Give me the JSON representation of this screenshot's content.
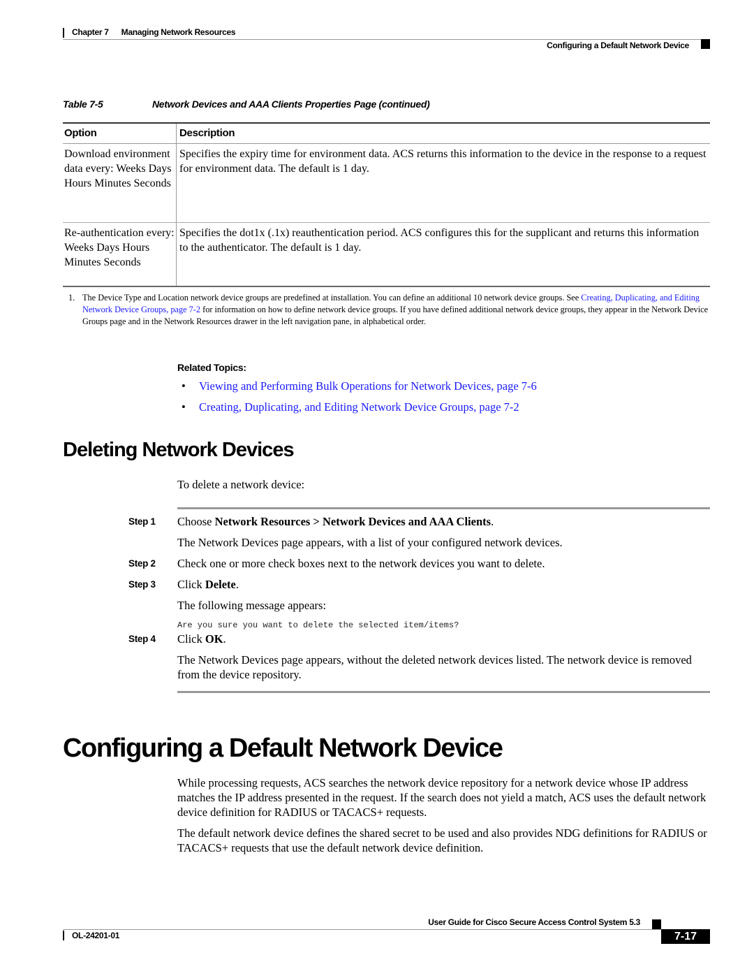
{
  "header": {
    "chapter_label": "Chapter 7",
    "chapter_title": "Managing Network Resources",
    "section_title": "Configuring a Default Network Device"
  },
  "table": {
    "caption_number": "Table 7-5",
    "caption_title": "Network Devices and AAA Clients Properties Page (continued)",
    "columns": [
      "Option",
      "Description"
    ],
    "rows": [
      {
        "option": "Download environment data every: Weeks Days Hours Minutes Seconds",
        "description": "Specifies the expiry time for environment data. ACS returns this information to the device in the response to a request for environment data. The default is 1 day."
      },
      {
        "option": "Re-authentication every: Weeks Days Hours Minutes Seconds",
        "description": "Specifies the dot1x (.1x) reauthentication period. ACS configures this for the supplicant and returns this information to the authenticator. The default is 1 day."
      }
    ]
  },
  "footnote": {
    "number": "1.",
    "text_before": "The Device Type and Location network device groups are predefined at installation. You can define an additional 10 network device groups. See ",
    "link": "Creating, Duplicating, and Editing Network Device Groups, page 7-2",
    "text_after": " for information on how to define network device groups. If you have defined additional network device groups, they appear in the Network Device Groups page and in the Network Resources drawer in the left navigation pane, in alphabetical order."
  },
  "related_topics": {
    "title": "Related Topics:",
    "bullet": "•",
    "items": [
      "Viewing and Performing Bulk Operations for Network Devices, page 7-6",
      "Creating, Duplicating, and Editing Network Device Groups, page 7-2"
    ]
  },
  "deleting": {
    "heading": "Deleting Network Devices",
    "intro": "To delete a network device:",
    "steps": [
      {
        "label": "Step 1",
        "prefix": "Choose ",
        "bold": "Network Resources > Network Devices and AAA Clients",
        "suffix": ".",
        "result": "The Network Devices page appears, with a list of your configured network devices."
      },
      {
        "label": "Step 2",
        "text": "Check one or more check boxes next to the network devices you want to delete."
      },
      {
        "label": "Step 3",
        "prefix": "Click ",
        "bold": "Delete",
        "suffix": ".",
        "result": "The following message appears:",
        "message": "Are you sure you want to delete the selected item/items?"
      },
      {
        "label": "Step 4",
        "prefix": "Click ",
        "bold": "OK",
        "suffix": ".",
        "result": "The Network Devices page appears, without the deleted network devices listed. The network device is removed from the device repository."
      }
    ]
  },
  "configuring": {
    "heading": "Configuring a Default Network Device",
    "paragraphs": [
      "While processing requests, ACS searches the network device repository for a network device whose IP address matches the IP address presented in the request. If the search does not yield a match, ACS uses the default network device definition for RADIUS or TACACS+ requests.",
      "The default network device defines the shared secret to be used and also provides NDG definitions for RADIUS or TACACS+ requests that use the default network device definition."
    ]
  },
  "footer": {
    "guide_title": "User Guide for Cisco Secure Access Control System 5.3",
    "doc_number": "OL-24201-01",
    "page_number": "7-17"
  }
}
